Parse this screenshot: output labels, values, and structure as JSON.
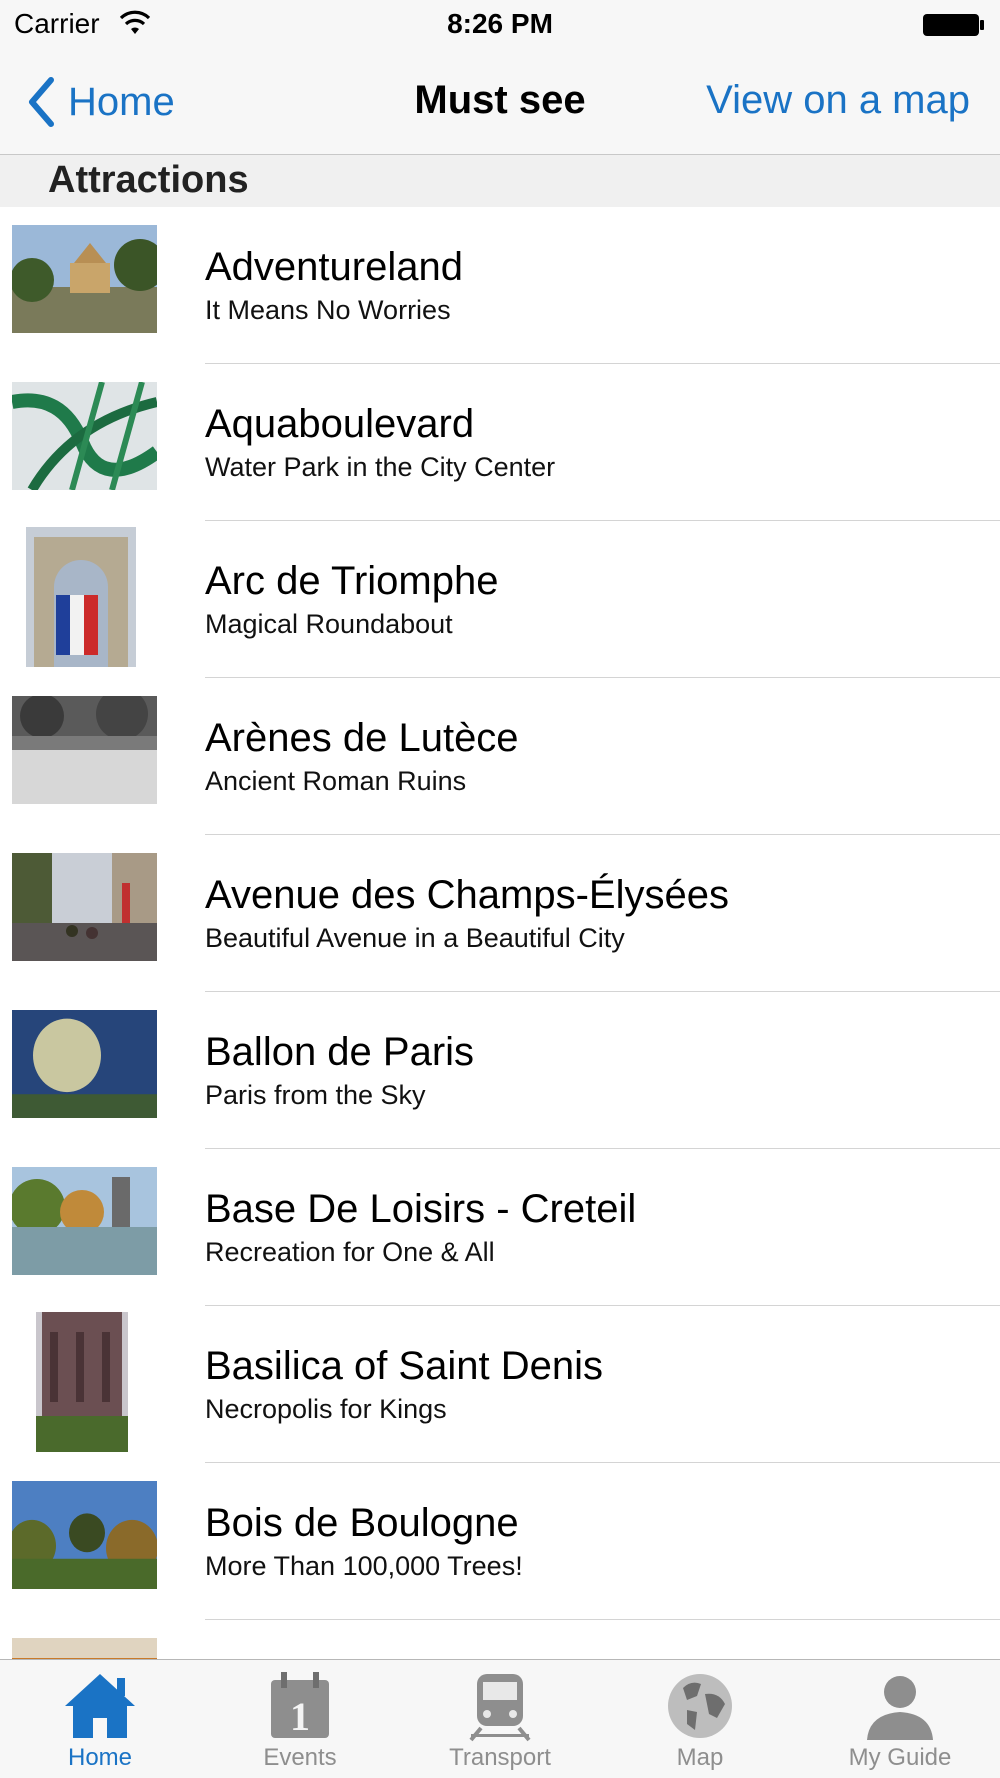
{
  "status_bar": {
    "carrier": "Carrier",
    "time": "8:26 PM"
  },
  "nav": {
    "back_label": "Home",
    "title": "Must see",
    "right_action": "View on a map"
  },
  "section": {
    "title": "Attractions"
  },
  "items": [
    {
      "title": "Adventureland",
      "subtitle": "It Means No Worries"
    },
    {
      "title": "Aquaboulevard",
      "subtitle": "Water Park in the City Center"
    },
    {
      "title": "Arc de Triomphe",
      "subtitle": "Magical Roundabout"
    },
    {
      "title": "Arènes de Lutèce",
      "subtitle": "Ancient Roman Ruins"
    },
    {
      "title": "Avenue des Champs-Élysées",
      "subtitle": "Beautiful Avenue in a Beautiful City"
    },
    {
      "title": "Ballon de Paris",
      "subtitle": "Paris from the Sky"
    },
    {
      "title": "Base De Loisirs - Creteil",
      "subtitle": "Recreation for One & All"
    },
    {
      "title": "Basilica of Saint Denis",
      "subtitle": "Necropolis for Kings"
    },
    {
      "title": "Bois de Boulogne",
      "subtitle": "More Than 100,000 Trees!"
    }
  ],
  "tabs": [
    {
      "label": "Home",
      "icon": "home-icon",
      "active": true
    },
    {
      "label": "Events",
      "icon": "calendar-icon",
      "active": false
    },
    {
      "label": "Transport",
      "icon": "train-icon",
      "active": false
    },
    {
      "label": "Map",
      "icon": "globe-icon",
      "active": false
    },
    {
      "label": "My Guide",
      "icon": "person-icon",
      "active": false
    }
  ],
  "colors": {
    "accent": "#1a73c5",
    "inactive_tab": "#8e8e8e",
    "bar_background": "#f7f7f7"
  }
}
